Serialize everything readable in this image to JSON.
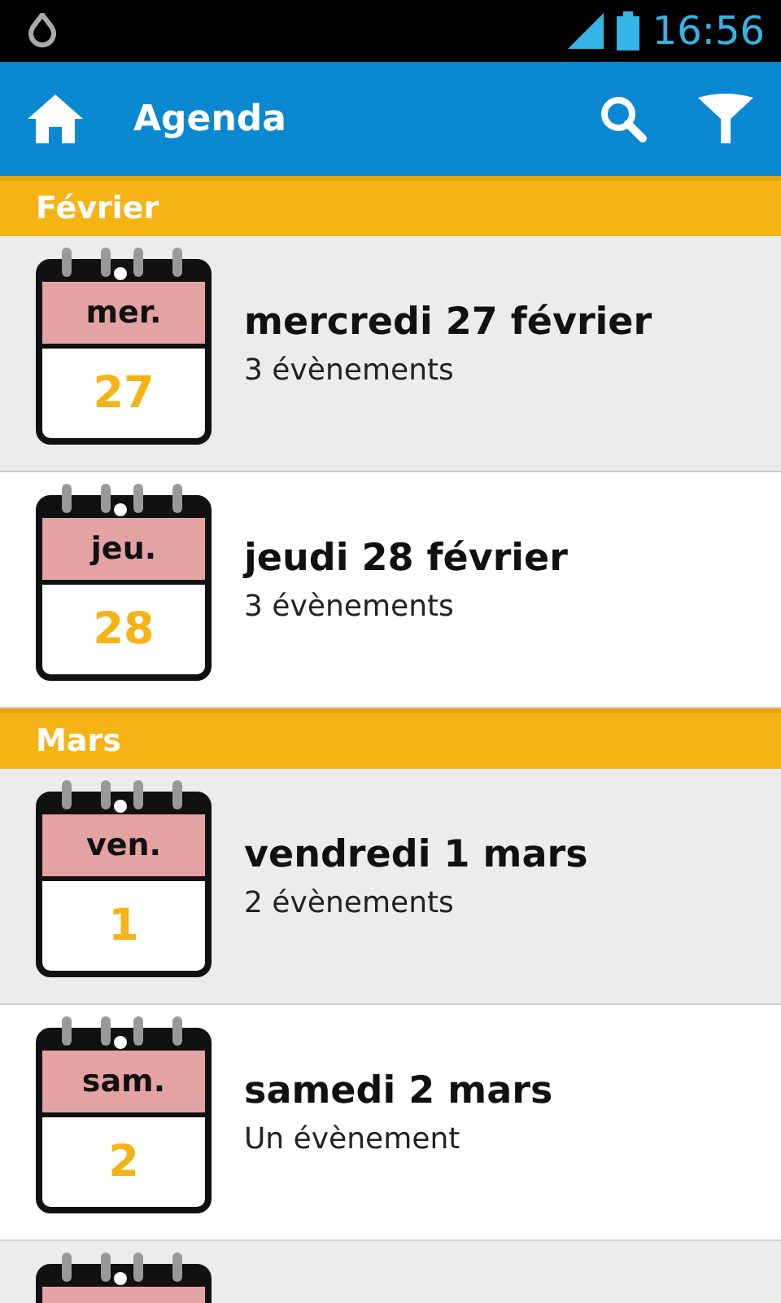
{
  "status_bar": {
    "time": "16:56"
  },
  "app_bar": {
    "title": "Agenda"
  },
  "sections": [
    {
      "title": "Février",
      "days": [
        {
          "kind": "day",
          "weekday": "mer.",
          "number": "27",
          "title": "mercredi 27 février",
          "subtitle": "3 évènements"
        },
        {
          "kind": "day",
          "weekday": "jeu.",
          "number": "28",
          "title": "jeudi 28 février",
          "subtitle": "3 évènements"
        }
      ]
    },
    {
      "title": "Mars",
      "days": [
        {
          "kind": "day",
          "weekday": "ven.",
          "number": "1",
          "title": "vendredi 1 mars",
          "subtitle": "2 évènements"
        },
        {
          "kind": "day",
          "weekday": "sam.",
          "number": "2",
          "title": "samedi 2 mars",
          "subtitle": "Un évènement"
        },
        {
          "kind": "partial"
        }
      ]
    }
  ]
}
